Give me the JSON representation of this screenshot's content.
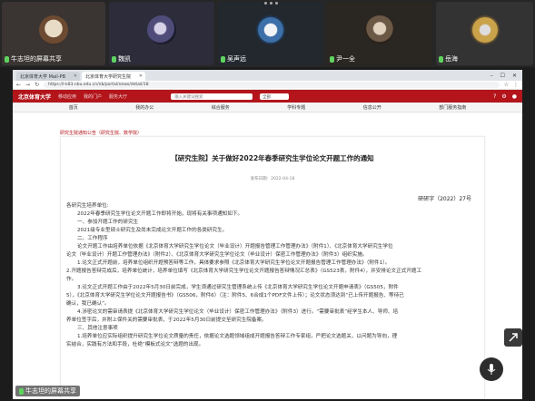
{
  "participants": [
    {
      "name": "牛志坦的屏幕共享"
    },
    {
      "name": "魏凯"
    },
    {
      "name": "吴声远"
    },
    {
      "name": "尹一全"
    },
    {
      "name": "岳海"
    }
  ],
  "browser": {
    "tabs": [
      "北京体育大学 Mail-PB",
      "北京体育大学研究生院"
    ],
    "url": "https://l-k83.nbu.edu.cn/nb/portal/news/detail/18"
  },
  "site": {
    "logo": "北京体育大学",
    "head_nav": [
      "移动应用",
      "我的门户",
      "服务大厅"
    ],
    "search_placeholder": "输入关键词搜索",
    "select_value": "全部",
    "menu": [
      "首页",
      "我的办公",
      "综合服务",
      "学科专题",
      "信息公开",
      "部门服务指南"
    ]
  },
  "breadcrumb": "研究生院通知公告（研究生院、数学院）",
  "document": {
    "title": "【研究生院】关于做好2022年春季研究生学位论文开题工作的通知",
    "meta": "发布日期：2022-04-18",
    "docnum": "研研字（2022）27号",
    "paragraphs": [
      "各研究生培养单位:",
      "2022年春季研究生学位论文开题工作即将开始，现将有关事项通知如下。",
      "一、参加开题工作的研究生",
      "2021级专业型硕士研究生及尚未完成论文开题工作的各类研究生。",
      "二、工作程序",
      "论文开题工作由培养单位依据《北京体育大学研究生学位论文（毕业设计）开题报告管理工作管理办法》（附件1）、《北京体育大学研究生学位",
      "论文（毕业设计）开题工作管理办法》（附件2）、《北京体育大学研究生学位论文（毕业设计）保密工作管理办法》（附件3）组织实施。",
      "1.论文正式开题前，培养单位组织开题预答辩等工作，具体要求参照《北京体育大学研究生学位论文开题报告管理工作管理办法》（附件1）。",
      "2.开题报告答辩完成后，培养单位统计，培养单位填写《北京体育大学研究生学位论文开题报告答辩情况汇总表》（GS523表，附件4），并安排论文正式开题工",
      "作。",
      "3.论文正式开题工作由于2022年5月30日前完成，学生须通过研究生管理系统上传《北京体育大学研究生学位论文开题申请表》（GS505，附件",
      "5），《北京体育大学研究生学位论文开题报告书》（GS506，附件6）（注：附件5、6合成1个PDF文件上传）；论文状态须达到“已上传开题报告、等待已",
      "确认，我已确认”。",
      "4.涉密论文的需审请表提《北京体育大学研究生学位论文（毕业设计）保密工作管理办法》（附件3）进行。“需要审批表”经学生本人、导师、培",
      "养单位签字后，并附上保件关的需要审批表，于2022年5月30日前提交至研究生院备案。",
      "三、其他注意事项",
      "1.培养单位应实际组织提升研究生学位论文质量的责任，依据论文选题领域组成开题报告答辩工作专家组，严把论文选题关，以问题为导向，理",
      "实结合，实践有方法和手段，杜绝“模板式论文”选题的出现。"
    ]
  }
}
